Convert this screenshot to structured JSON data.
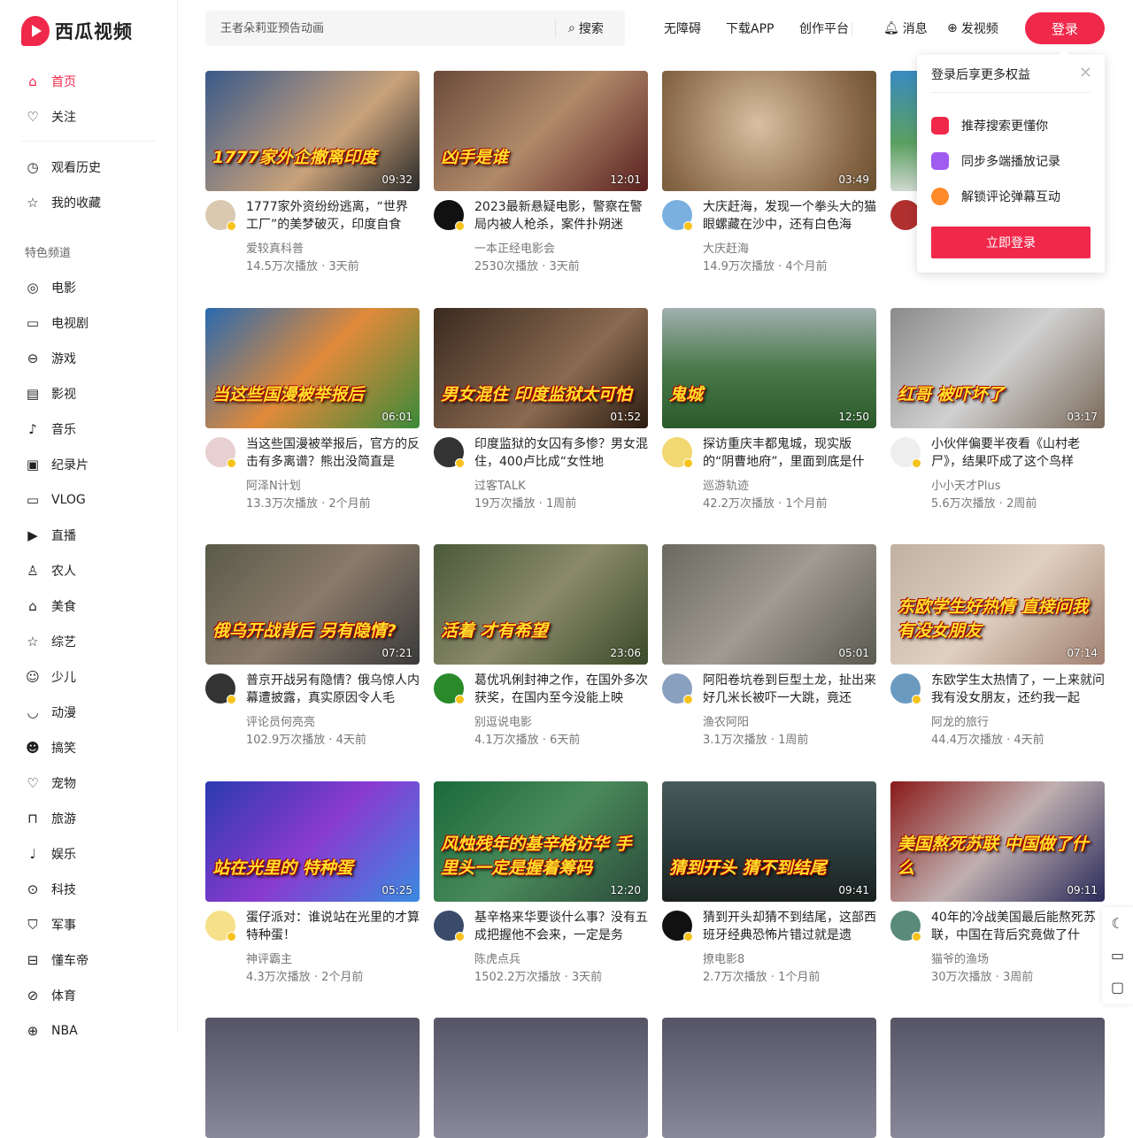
{
  "logo": {
    "text": "西瓜视频"
  },
  "search": {
    "placeholder": "王者朵莉亚预告动画",
    "button": "搜索"
  },
  "topnav": {
    "accessibility": "无障碍",
    "download": "下载APP",
    "creator": "创作平台",
    "messages": "消息",
    "upload": "发视频",
    "login": "登录"
  },
  "sidebar": {
    "main": [
      {
        "label": "首页",
        "icon": "home-icon"
      },
      {
        "label": "关注",
        "icon": "heart-icon"
      }
    ],
    "personal": [
      {
        "label": "观看历史",
        "icon": "clock-icon"
      },
      {
        "label": "我的收藏",
        "icon": "star-icon"
      }
    ],
    "section_title": "特色频道",
    "channels": [
      {
        "label": "电影",
        "icon": "film-reel-icon",
        "g": "◎"
      },
      {
        "label": "电视剧",
        "icon": "tv-icon",
        "g": "▭"
      },
      {
        "label": "游戏",
        "icon": "game-icon",
        "g": "⊖"
      },
      {
        "label": "影视",
        "icon": "clapper-icon",
        "g": "▤"
      },
      {
        "label": "音乐",
        "icon": "music-icon",
        "g": "♪"
      },
      {
        "label": "纪录片",
        "icon": "documentary-icon",
        "g": "▣"
      },
      {
        "label": "VLOG",
        "icon": "camera-icon",
        "g": "▭"
      },
      {
        "label": "直播",
        "icon": "live-icon",
        "g": "▶"
      },
      {
        "label": "农人",
        "icon": "farmer-icon",
        "g": "♙"
      },
      {
        "label": "美食",
        "icon": "chef-hat-icon",
        "g": "⌂"
      },
      {
        "label": "综艺",
        "icon": "magic-wand-icon",
        "g": "☆"
      },
      {
        "label": "少儿",
        "icon": "child-face-icon",
        "g": "☺"
      },
      {
        "label": "动漫",
        "icon": "anime-icon",
        "g": "◡"
      },
      {
        "label": "搞笑",
        "icon": "laugh-icon",
        "g": "☻"
      },
      {
        "label": "宠物",
        "icon": "pet-icon",
        "g": "♡"
      },
      {
        "label": "旅游",
        "icon": "luggage-icon",
        "g": "⊓"
      },
      {
        "label": "娱乐",
        "icon": "microphone-icon",
        "g": "♩"
      },
      {
        "label": "科技",
        "icon": "tech-icon",
        "g": "⊙"
      },
      {
        "label": "军事",
        "icon": "military-shield-icon",
        "g": "⛉"
      },
      {
        "label": "懂车帝",
        "icon": "car-icon",
        "g": "⊟"
      },
      {
        "label": "体育",
        "icon": "sports-icon",
        "g": "⊘"
      },
      {
        "label": "NBA",
        "icon": "basketball-icon",
        "g": "⊕"
      }
    ]
  },
  "popup": {
    "title": "登录后享更多权益",
    "benefits": [
      "推荐搜索更懂你",
      "同步多端播放记录",
      "解锁评论弹幕互动"
    ],
    "button": "立即登录",
    "colors": [
      "#f0284a",
      "#a05cf0",
      "#ff8a2a"
    ]
  },
  "videos": [
    {
      "cap": "1777家外企撤离印度",
      "dur": "09:32",
      "title": "1777家外资纷纷逃离，“世界工厂”的美梦破灭，印度自食",
      "author": "爱较真科普",
      "stats": "14.5万次播放 · 3天前",
      "bg": "linear-gradient(135deg,#3a5a8a,#c9a27a 60%,#2a2a2a)",
      "av": "#d9c9b0"
    },
    {
      "cap": "凶手是谁",
      "dur": "12:01",
      "title": "2023最新悬疑电影，警察在警局内被人枪杀，案件扑朔迷",
      "author": "一本正经电影会",
      "stats": "2530次播放 · 3天前",
      "bg": "linear-gradient(135deg,#6a4a3a,#b08a6a 50%,#5a2020)",
      "av": "#111"
    },
    {
      "cap": "",
      "dur": "03:49",
      "title": "大庆赶海，发现一个拳头大的猫眼螺藏在沙中，还有白色海",
      "author": "大庆赶海",
      "stats": "14.9万次播放 · 4个月前",
      "bg": "radial-gradient(circle at 45% 45%,#d8c0a0,#8a6a4a 70%,#6a5030)",
      "av": "#7ab0e0"
    },
    {
      "cap": "",
      "dur": "",
      "title": "",
      "author": "",
      "stats": "",
      "bg": "linear-gradient(180deg,#3a8ac0,#5aa060 60%,#d0d8d0)",
      "av": "#b03030"
    },
    {
      "cap": "当这些国漫被举报后",
      "dur": "06:01",
      "title": "当这些国漫被举报后，官方的反击有多离谱？熊出没简直是",
      "author": "阿泽N计划",
      "stats": "13.3万次播放 · 2个月前",
      "bg": "linear-gradient(135deg,#2a6ab0,#e08a3a 50%,#3a8a3a)",
      "av": "#e8d0d0"
    },
    {
      "cap": "男女混住 印度监狱太可怕",
      "dur": "01:52",
      "title": "印度监狱的女囚有多惨？男女混住，400卢比成“女性地",
      "author": "过客TALK",
      "stats": "19万次播放 · 1周前",
      "bg": "linear-gradient(135deg,#3a2a20,#8a6a50 60%,#2a1a10)",
      "av": "#333"
    },
    {
      "cap": "鬼城",
      "dur": "12:50",
      "title": "探访重庆丰都鬼城，现实版的“阴曹地府”，里面到底是什么",
      "author": "巡游轨迹",
      "stats": "42.2万次播放 · 1个月前",
      "bg": "linear-gradient(180deg,#a0b0b0,#4a7a4a 50%,#2a5a2a)",
      "av": "#f2d870"
    },
    {
      "cap": "红哥 被吓坏了",
      "dur": "03:17",
      "title": "小伙伴偏要半夜看《山村老尸》，结果吓成了这个鸟样",
      "author": "小小天才Plus",
      "stats": "5.6万次播放 · 2周前",
      "bg": "linear-gradient(135deg,#8a8a8a,#d0d0d0 50%,#7a6a5a)",
      "av": "#eee"
    },
    {
      "cap": "俄乌开战背后 另有隐情?",
      "dur": "07:21",
      "title": "普京开战另有隐情？俄乌惊人内幕遭披露，真实原因令人毛",
      "author": "评论员何亮亮",
      "stats": "102.9万次播放 · 4天前",
      "bg": "linear-gradient(135deg,#5a5a4a,#8a7a6a 50%,#3a3a3a)",
      "av": "#333"
    },
    {
      "cap": "活着 才有希望",
      "dur": "23:06",
      "title": "葛优巩俐封神之作，在国外多次获奖，在国内至今没能上映",
      "author": "别逗说电影",
      "stats": "4.1万次播放 · 6天前",
      "bg": "linear-gradient(135deg,#4a5a3a,#8a8a6a 50%,#3a4a2a)",
      "av": "#2a8a2a"
    },
    {
      "cap": "",
      "dur": "05:01",
      "title": "阿阳卷坑卷到巨型土龙，扯出来好几米长被吓一大跳，竟还",
      "author": "渔农阿阳",
      "stats": "3.1万次播放 · 1周前",
      "bg": "linear-gradient(135deg,#6a6a60,#a09a90 50%,#5a5a50)",
      "av": "#8aa0c0"
    },
    {
      "cap": "东欧学生好热情 直接问我有没女朋友",
      "dur": "07:14",
      "title": "东欧学生太热情了，一上来就问我有没女朋友，还约我一起",
      "author": "阿龙的旅行",
      "stats": "44.4万次播放 · 4天前",
      "bg": "linear-gradient(135deg,#c0b0a0,#e0d0c0 50%,#a08070)",
      "av": "#6a9ac0"
    },
    {
      "cap": "站在光里的 特种蛋",
      "dur": "05:25",
      "title": "蛋仔派对：谁说站在光里的才算特种蛋！",
      "author": "神评霸主",
      "stats": "4.3万次播放 · 2个月前",
      "bg": "linear-gradient(135deg,#2a3ab0,#8a3ad0 50%,#3a8ae0)",
      "av": "#f7e08a"
    },
    {
      "cap": "风烛残年的基辛格访华 手里头一定是握着筹码",
      "dur": "12:20",
      "title": "基辛格来华要谈什么事？没有五成把握他不会来，一定是务",
      "author": "陈虎点兵",
      "stats": "1502.2万次播放 · 3天前",
      "bg": "linear-gradient(135deg,#1a6a3a,#4a8a5a 50%,#2a4a3a)",
      "av": "#3a4a6a"
    },
    {
      "cap": "猜到开头 猜不到结尾",
      "dur": "09:41",
      "title": "猜到开头却猜不到结尾，这部西班牙经典恐怖片错过就是遗",
      "author": "撩电影8",
      "stats": "2.7万次播放 · 1个月前",
      "bg": "linear-gradient(180deg,#4a5a5a,#2a3a3a 60%,#1a2020)",
      "av": "#111"
    },
    {
      "cap": "美国熬死苏联 中国做了什么",
      "dur": "09:11",
      "title": "40年的冷战美国最后能熬死苏联，中国在背后究竟做了什",
      "author": "猫爷的渔场",
      "stats": "30万次播放 · 3周前",
      "bg": "linear-gradient(135deg,#8a1a1a,#c0b0b0 50%,#2a2a5a)",
      "av": "#5a8a7a"
    }
  ],
  "tools": [
    {
      "icon": "moon-icon",
      "g": "☾"
    },
    {
      "icon": "screen-icon",
      "g": "▭"
    },
    {
      "icon": "feedback-icon",
      "g": "▢"
    }
  ]
}
